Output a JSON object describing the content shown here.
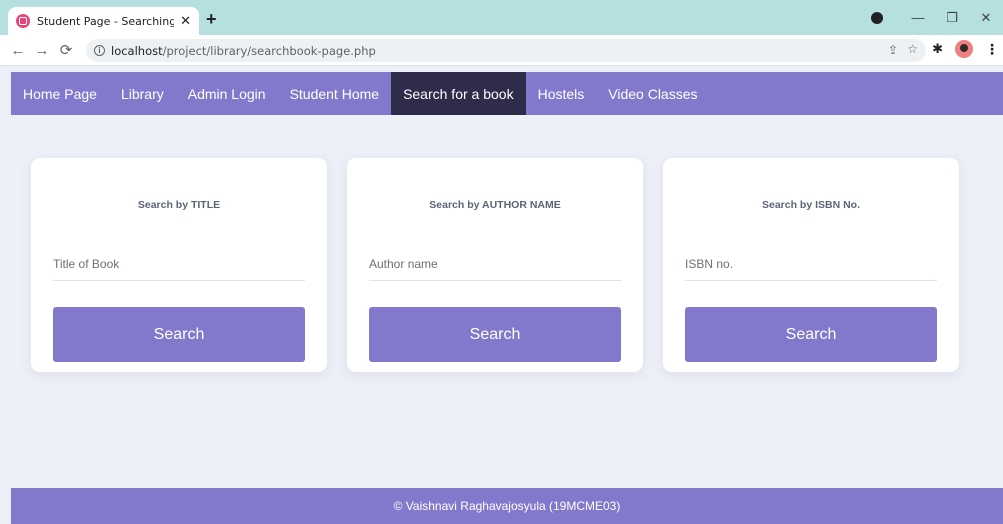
{
  "browser": {
    "tab_title": "Student Page - Searching a Book",
    "tab_close": "✕",
    "new_tab": "+",
    "url_host": "localhost",
    "url_path": "/project/library/searchbook-page.php",
    "window_controls": {
      "minimize": "—",
      "restore": "❐",
      "close": "✕"
    }
  },
  "nav": {
    "items": [
      {
        "label": "Home Page"
      },
      {
        "label": "Library"
      },
      {
        "label": "Admin Login"
      },
      {
        "label": "Student Home"
      },
      {
        "label": "Search for a book",
        "active": true
      },
      {
        "label": "Hostels"
      },
      {
        "label": "Video Classes"
      }
    ]
  },
  "cards": [
    {
      "title": "Search by TITLE",
      "placeholder": "Title of Book",
      "button": "Search"
    },
    {
      "title": "Search by AUTHOR NAME",
      "placeholder": "Author name",
      "button": "Search"
    },
    {
      "title": "Search by ISBN No.",
      "placeholder": "ISBN no.",
      "button": "Search"
    }
  ],
  "footer": {
    "text": "© Vaishnavi Raghavajosyula (19MCME03)"
  },
  "colors": {
    "accent": "#8279cc",
    "nav_active": "#2f2b4a",
    "background": "#eef0f8",
    "tabstrip": "#b6dfe0"
  }
}
